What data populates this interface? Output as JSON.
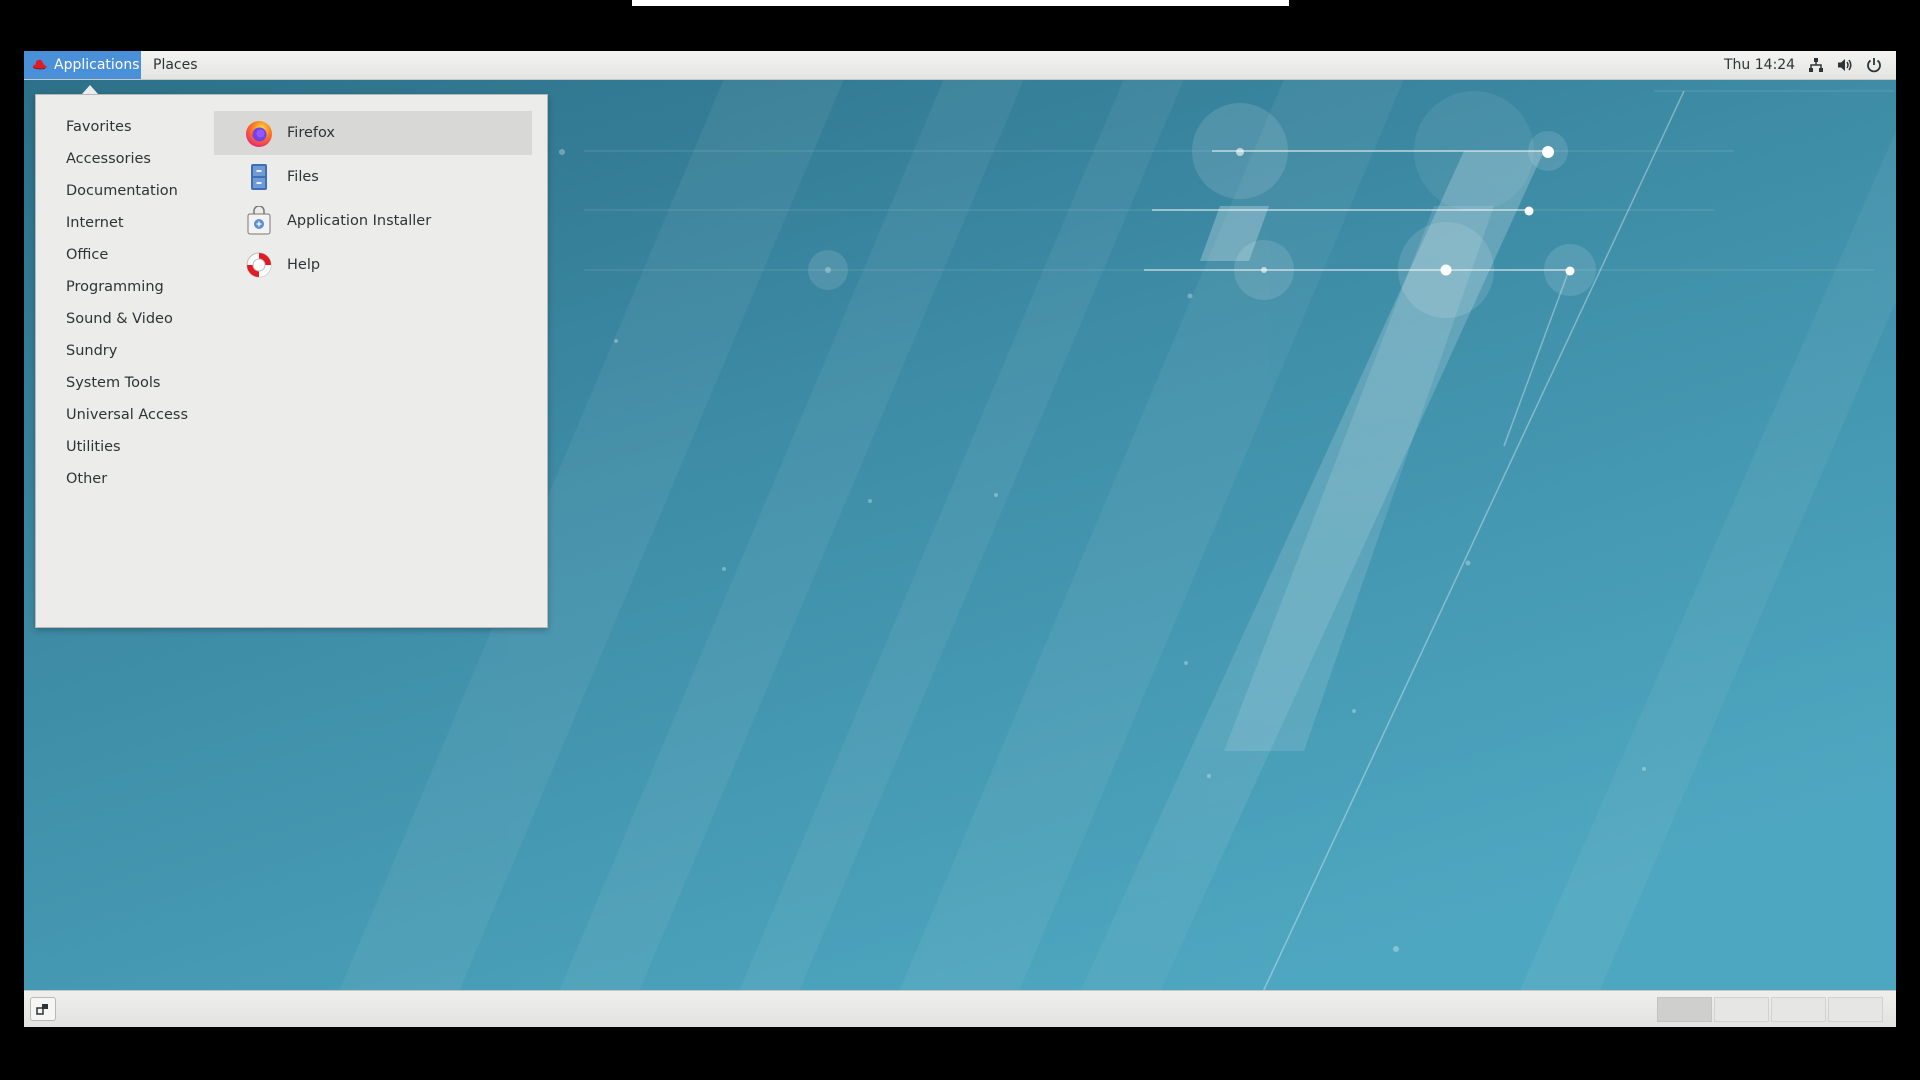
{
  "top_panel": {
    "applications_label": "Applications",
    "places_label": "Places",
    "clock": "Thu 14:24",
    "tray_icons": [
      "network-icon",
      "volume-icon",
      "power-icon"
    ]
  },
  "app_menu": {
    "categories": [
      {
        "label": "Favorites"
      },
      {
        "label": "Accessories"
      },
      {
        "label": "Documentation"
      },
      {
        "label": "Internet"
      },
      {
        "label": "Office"
      },
      {
        "label": "Programming"
      },
      {
        "label": "Sound & Video"
      },
      {
        "label": "Sundry"
      },
      {
        "label": "System Tools"
      },
      {
        "label": "Universal Access"
      },
      {
        "label": "Utilities"
      },
      {
        "label": "Other"
      }
    ],
    "apps": [
      {
        "label": "Firefox",
        "icon": "firefox-icon",
        "selected": true
      },
      {
        "label": "Files",
        "icon": "files-icon"
      },
      {
        "label": "Application Installer",
        "icon": "application-installer-icon"
      },
      {
        "label": "Help",
        "icon": "help-icon"
      }
    ]
  },
  "bottom_panel": {
    "show_desktop_icon": "show-desktop-icon",
    "workspaces": [
      {
        "active": true
      },
      {
        "active": false
      },
      {
        "active": false
      },
      {
        "active": false
      }
    ]
  },
  "colors": {
    "panel_accent": "#4a90d9",
    "desktop_bg": "#3f8ea8"
  }
}
